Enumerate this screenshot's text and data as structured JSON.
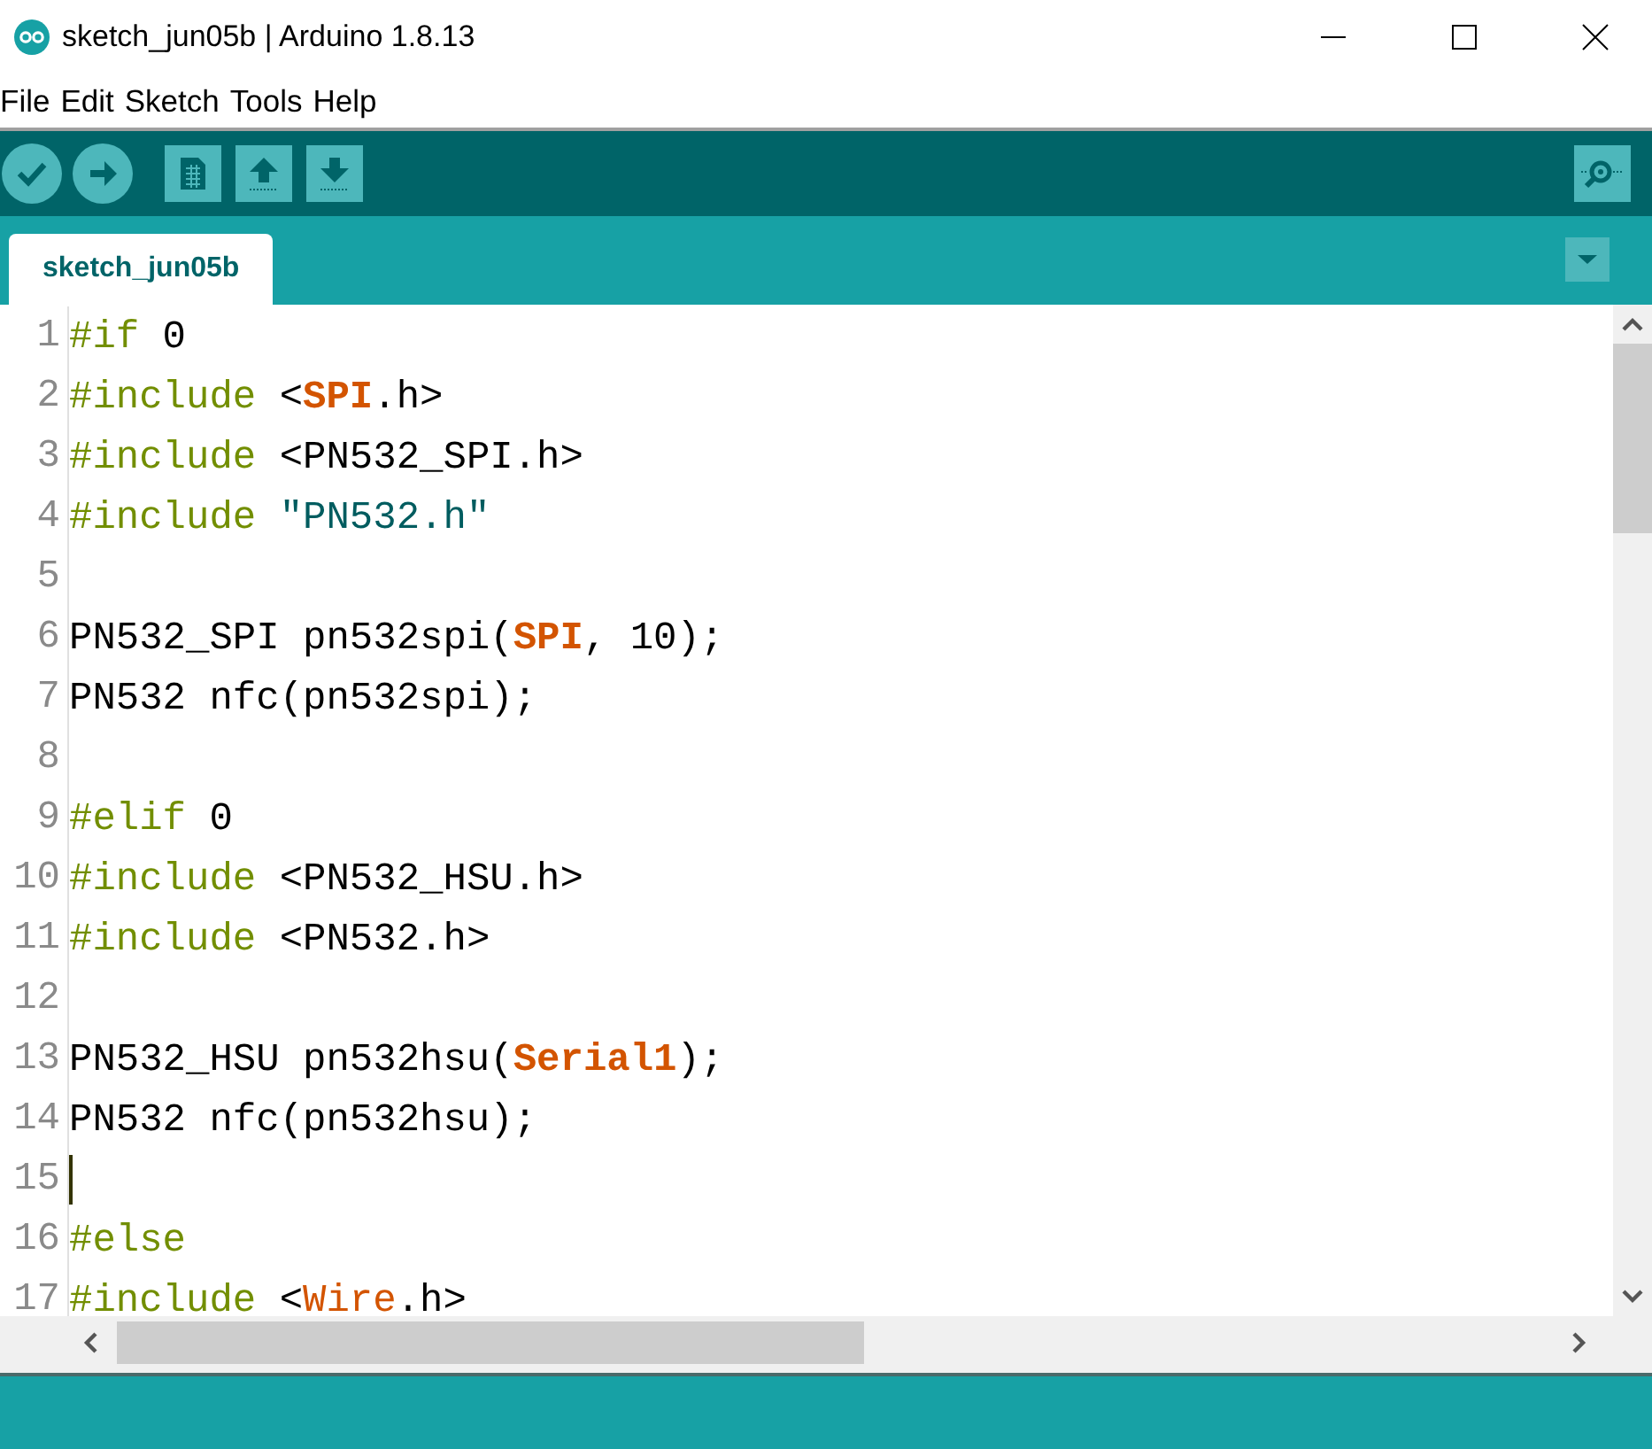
{
  "window": {
    "title": "sketch_jun05b | Arduino 1.8.13"
  },
  "menu": [
    "File",
    "Edit",
    "Sketch",
    "Tools",
    "Help"
  ],
  "toolbar": [
    {
      "kind": "verify"
    },
    {
      "kind": "upload"
    },
    {
      "kind": "new"
    },
    {
      "kind": "open"
    },
    {
      "kind": "save"
    }
  ],
  "tabs": [
    {
      "label": "sketch_jun05b",
      "selected": true
    }
  ],
  "editor": {
    "lines": [
      {
        "number": "1",
        "caret": false,
        "tokens": [
          {
            "text": "#if",
            "kind": "keyword"
          },
          {
            "text": " 0",
            "kind": "plain"
          }
        ]
      },
      {
        "number": "2",
        "caret": false,
        "tokens": [
          {
            "text": "#include",
            "kind": "keyword"
          },
          {
            "text": " <",
            "kind": "plain"
          },
          {
            "text": "SPI",
            "kind": "constant"
          },
          {
            "text": ".h>",
            "kind": "plain"
          }
        ]
      },
      {
        "number": "3",
        "caret": false,
        "tokens": [
          {
            "text": "#include",
            "kind": "keyword"
          },
          {
            "text": " <PN532_SPI.h>",
            "kind": "plain"
          }
        ]
      },
      {
        "number": "4",
        "caret": false,
        "tokens": [
          {
            "text": "#include",
            "kind": "keyword"
          },
          {
            "text": " \"PN532.h\"",
            "kind": "string"
          }
        ]
      },
      {
        "number": "5",
        "caret": false
      },
      {
        "number": "6",
        "caret": false,
        "tokens": [
          {
            "text": "PN532_SPI pn532spi(",
            "kind": "plain"
          },
          {
            "text": "SPI",
            "kind": "constant"
          },
          {
            "text": ", 10);",
            "kind": "plain"
          }
        ]
      },
      {
        "number": "7",
        "caret": false,
        "tokens": [
          {
            "text": "PN532 nfc(pn532spi);",
            "kind": "plain"
          }
        ]
      },
      {
        "number": "8",
        "caret": false
      },
      {
        "number": "9",
        "caret": false,
        "tokens": [
          {
            "text": "#elif",
            "kind": "keyword"
          },
          {
            "text": " 0",
            "kind": "plain"
          }
        ]
      },
      {
        "number": "10",
        "caret": false,
        "tokens": [
          {
            "text": "#include",
            "kind": "keyword"
          },
          {
            "text": " <PN532_HSU.h>",
            "kind": "plain"
          }
        ]
      },
      {
        "number": "11",
        "caret": false,
        "tokens": [
          {
            "text": "#include",
            "kind": "keyword"
          },
          {
            "text": " <PN532.h>",
            "kind": "plain"
          }
        ]
      },
      {
        "number": "12",
        "caret": false
      },
      {
        "number": "13",
        "caret": false,
        "tokens": [
          {
            "text": "PN532_HSU pn532hsu(",
            "kind": "plain"
          },
          {
            "text": "Serial1",
            "kind": "constant"
          },
          {
            "text": ");",
            "kind": "plain"
          }
        ]
      },
      {
        "number": "14",
        "caret": false,
        "tokens": [
          {
            "text": "PN532 nfc(pn532hsu);",
            "kind": "plain"
          }
        ]
      },
      {
        "number": "15",
        "caret": true
      },
      {
        "number": "16",
        "caret": false,
        "tokens": [
          {
            "text": "#else",
            "kind": "keyword"
          }
        ]
      },
      {
        "number": "17",
        "caret": false,
        "tokens": [
          {
            "text": "#include",
            "kind": "keyword"
          },
          {
            "text": " <",
            "kind": "plain"
          },
          {
            "text": "Wire",
            "kind": "library"
          },
          {
            "text": ".h>",
            "kind": "plain"
          }
        ]
      }
    ]
  }
}
